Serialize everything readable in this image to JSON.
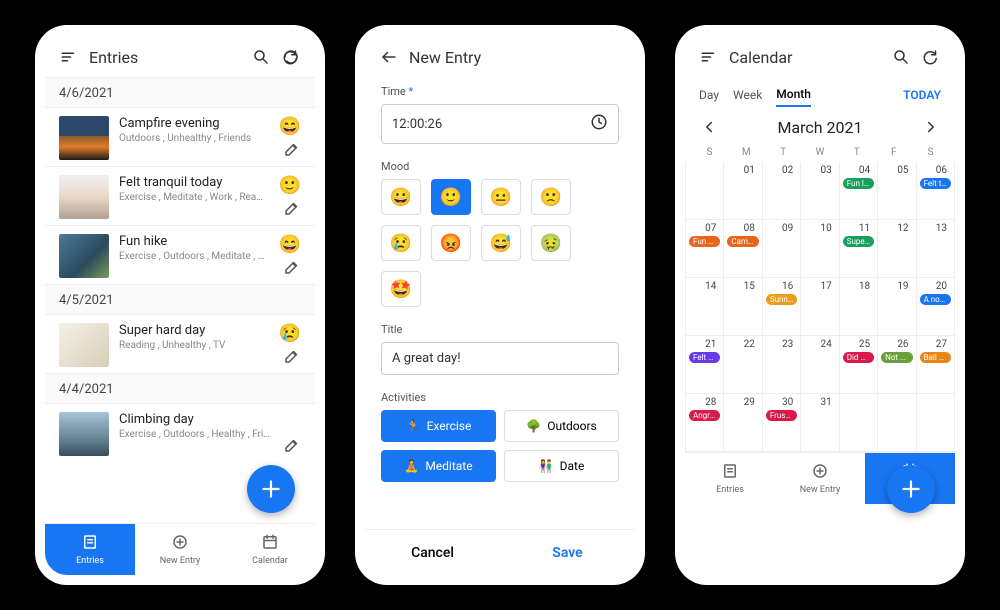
{
  "entries_screen": {
    "title": "Entries",
    "groups": [
      {
        "date": "4/6/2021",
        "items": [
          {
            "title": "Campfire evening",
            "tags": "Outdoors , Unhealthy , Friends",
            "mood": "😄",
            "img": "linear-gradient(to bottom,#2b4a6b 45%,#8b5a2b 45%,#e07c2b 70%,#1a1a1a 100%)"
          },
          {
            "title": "Felt tranquil today",
            "tags": "Exercise , Meditate , Work , Reading , Healt…",
            "mood": "🙂",
            "img": "linear-gradient(180deg,#f0f0f0 0%,#e8d8c8 50%,#b0a090 100%)"
          },
          {
            "title": "Fun hike",
            "tags": "Exercise , Outdoors , Meditate , Date , Heal…",
            "mood": "😄",
            "img": "linear-gradient(135deg,#4a7a9b 0%,#2a4a5b 60%,#7a9b5a 100%)"
          }
        ]
      },
      {
        "date": "4/5/2021",
        "items": [
          {
            "title": "Super hard day",
            "tags": "Reading , Unhealthy , TV",
            "mood": "😢",
            "img": "linear-gradient(135deg,#f5f0e8 0%,#d8cdb8 100%)"
          }
        ]
      },
      {
        "date": "4/4/2021",
        "items": [
          {
            "title": "Climbing day",
            "tags": "Exercise , Outdoors , Healthy , Fri…",
            "mood": "",
            "img": "linear-gradient(180deg,#a8c4d8 0%,#5a7a8a 70%,#3a4a5a 100%)"
          }
        ]
      }
    ]
  },
  "new_entry_screen": {
    "title": "New Entry",
    "time_label": "Time",
    "time_value": "12:00:26",
    "mood_label": "Mood",
    "moods": [
      "😀",
      "🙂",
      "😐",
      "🙁",
      "😢",
      "😡",
      "😅",
      "🤢",
      "🤩"
    ],
    "selected_mood_index": 1,
    "title_label": "Title",
    "title_value": "A great day!",
    "activities_label": "Activities",
    "activities": [
      {
        "icon": "🏃",
        "label": "Exercise",
        "selected": true
      },
      {
        "icon": "🌳",
        "label": "Outdoors",
        "selected": false
      },
      {
        "icon": "🧘",
        "label": "Meditate",
        "selected": true
      },
      {
        "icon": "👫",
        "label": "Date",
        "selected": false
      }
    ],
    "cancel": "Cancel",
    "save": "Save"
  },
  "calendar_screen": {
    "title": "Calendar",
    "view_tabs": [
      "Day",
      "Week",
      "Month"
    ],
    "active_view_index": 2,
    "today_label": "TODAY",
    "month_title": "March 2021",
    "weekdays": [
      "S",
      "M",
      "T",
      "W",
      "T",
      "F",
      "S"
    ],
    "cells": [
      {
        "n": "",
        "events": []
      },
      {
        "n": "01",
        "events": []
      },
      {
        "n": "02",
        "events": []
      },
      {
        "n": "03",
        "events": []
      },
      {
        "n": "04",
        "events": [
          {
            "t": "Fun late n",
            "c": "#1aa05e"
          }
        ]
      },
      {
        "n": "05",
        "events": []
      },
      {
        "n": "06",
        "events": [
          {
            "t": "Felt tranq",
            "c": "#1976f2"
          }
        ]
      },
      {
        "n": "07",
        "events": [
          {
            "t": "Fun hike",
            "c": "#e8661a"
          }
        ]
      },
      {
        "n": "08",
        "events": [
          {
            "t": "Campfire",
            "c": "#e8661a"
          }
        ]
      },
      {
        "n": "09",
        "events": []
      },
      {
        "n": "10",
        "events": []
      },
      {
        "n": "11",
        "events": [
          {
            "t": "Super ha",
            "c": "#1aa05e"
          }
        ]
      },
      {
        "n": "12",
        "events": []
      },
      {
        "n": "13",
        "events": []
      },
      {
        "n": "14",
        "events": []
      },
      {
        "n": "15",
        "events": []
      },
      {
        "n": "16",
        "events": [
          {
            "t": "Sunny da",
            "c": "#e8a01a"
          }
        ]
      },
      {
        "n": "17",
        "events": []
      },
      {
        "n": "18",
        "events": []
      },
      {
        "n": "19",
        "events": []
      },
      {
        "n": "20",
        "events": [
          {
            "t": "A normal",
            "c": "#1976f2"
          }
        ]
      },
      {
        "n": "21",
        "events": [
          {
            "t": "Felt sick",
            "c": "#6a3ae8"
          }
        ]
      },
      {
        "n": "22",
        "events": []
      },
      {
        "n": "23",
        "events": []
      },
      {
        "n": "24",
        "events": []
      },
      {
        "n": "25",
        "events": [
          {
            "t": "Did not s",
            "c": "#d81a4a"
          }
        ]
      },
      {
        "n": "26",
        "events": [
          {
            "t": "Not a gre",
            "c": "#6aa03a"
          }
        ]
      },
      {
        "n": "27",
        "events": [
          {
            "t": "Ball gam",
            "c": "#e8861a"
          }
        ]
      },
      {
        "n": "28",
        "events": [
          {
            "t": "Angry tod",
            "c": "#d81a4a"
          }
        ]
      },
      {
        "n": "29",
        "events": []
      },
      {
        "n": "30",
        "events": [
          {
            "t": "Frustratin",
            "c": "#d81a4a"
          }
        ]
      },
      {
        "n": "31",
        "events": []
      },
      {
        "n": "",
        "events": []
      },
      {
        "n": "",
        "events": []
      },
      {
        "n": "",
        "events": []
      }
    ]
  },
  "nav": {
    "items": [
      {
        "label": "Entries",
        "icon": "entries"
      },
      {
        "label": "New Entry",
        "icon": "plus-circle"
      },
      {
        "label": "Calendar",
        "icon": "calendar"
      }
    ]
  }
}
